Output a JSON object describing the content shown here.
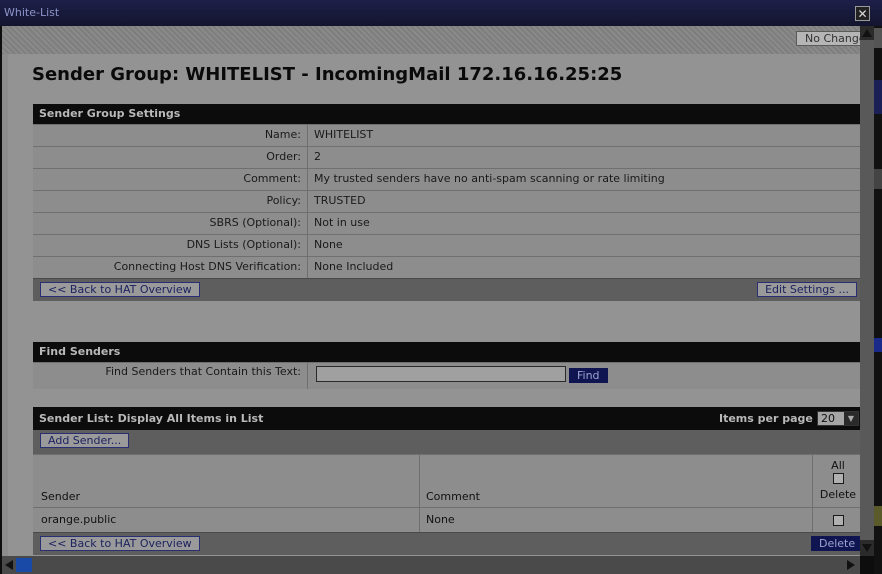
{
  "window": {
    "title": "White-List",
    "close_glyph": "✕"
  },
  "toolbar": {
    "no_change_label": "No Changes"
  },
  "page": {
    "title": "Sender Group: WHITELIST - IncomingMail 172.16.16.25:25"
  },
  "settings": {
    "heading": "Sender Group Settings",
    "rows": [
      {
        "label": "Name:",
        "value": "WHITELIST"
      },
      {
        "label": "Order:",
        "value": "2"
      },
      {
        "label": "Comment:",
        "value": "My trusted senders have no anti-spam scanning or rate limiting"
      },
      {
        "label": "Policy:",
        "value": "TRUSTED"
      },
      {
        "label": "SBRS (Optional):",
        "value": "Not in use"
      },
      {
        "label": "DNS Lists (Optional):",
        "value": "None"
      },
      {
        "label": "Connecting Host DNS Verification:",
        "value": "None Included"
      }
    ],
    "back_label": "<< Back to HAT Overview",
    "edit_label": "Edit Settings ..."
  },
  "find": {
    "heading": "Find Senders",
    "label": "Find Senders that Contain this Text:",
    "input_value": "",
    "button_label": "Find"
  },
  "sender_list": {
    "heading": "Sender List: Display All Items in List",
    "per_page_label": "Items per page",
    "per_page_value": "20",
    "add_label": "Add Sender...",
    "columns": {
      "sender": "Sender",
      "comment": "Comment",
      "all": "All",
      "delete": "Delete"
    },
    "rows": [
      {
        "sender": "orange.public",
        "comment": "None"
      }
    ],
    "back_label": "<< Back to HAT Overview",
    "delete_label": "Delete"
  },
  "colors": {
    "titlebar": "#1d1f49",
    "header": "#0c0c0c",
    "dark_button": "#0f1550"
  }
}
